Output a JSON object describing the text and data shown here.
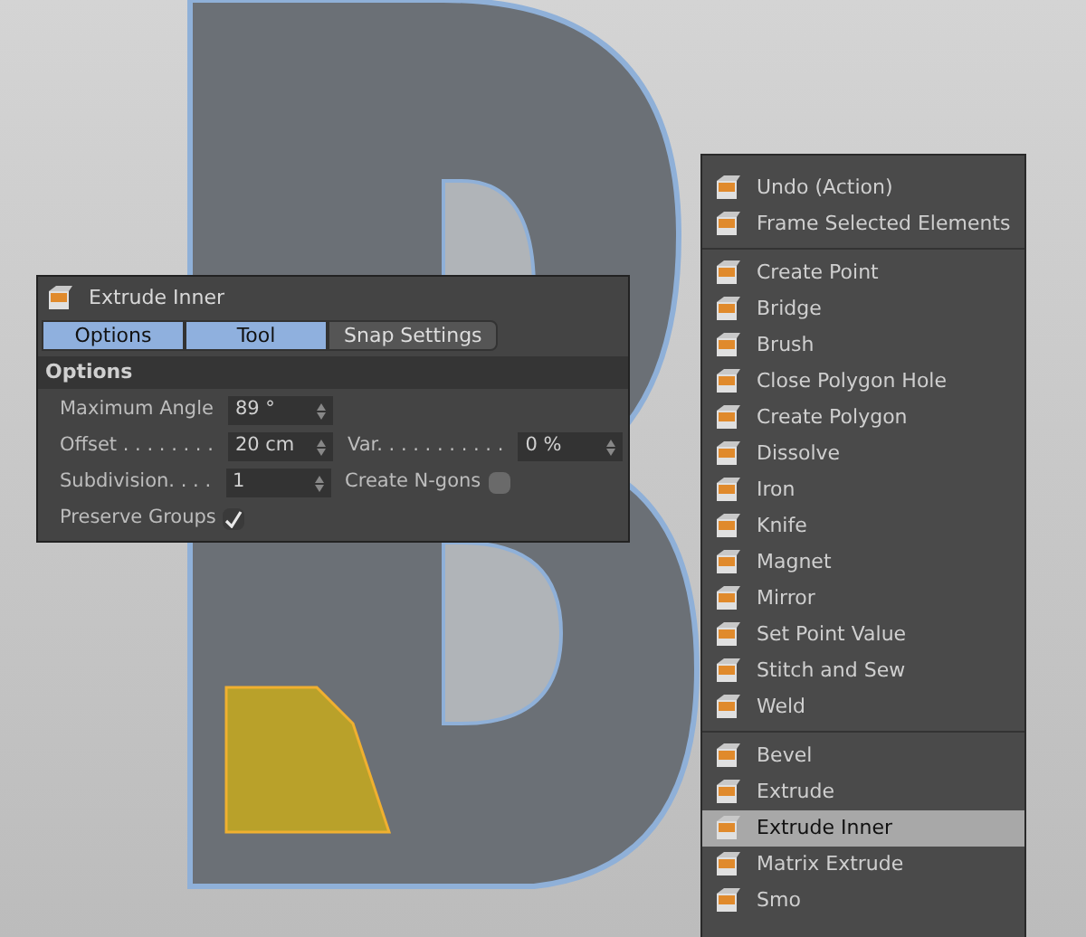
{
  "dialog": {
    "title": "Extrude Inner",
    "tabs": [
      {
        "label": "Options",
        "selected": true
      },
      {
        "label": "Tool",
        "selected": true
      },
      {
        "label": "Snap Settings",
        "selected": false
      }
    ],
    "section": "Options",
    "rows": [
      [
        {
          "kind": "number",
          "label": "Maximum Angle",
          "value": "89 °"
        }
      ],
      [
        {
          "kind": "number",
          "label": "Offset . . . . . . . .",
          "value": "20 cm"
        },
        {
          "kind": "number",
          "label": "Var. . . . . . . . . . .",
          "value": "0 %"
        }
      ],
      [
        {
          "kind": "number",
          "label": "Subdivision. . . .",
          "value": "1"
        },
        {
          "kind": "checkbox",
          "label": "Create N-gons",
          "checked": false
        }
      ],
      [
        {
          "kind": "checkbox",
          "label": "Preserve Groups",
          "checked": true
        }
      ]
    ]
  },
  "menu": {
    "sections": [
      [
        {
          "label": "Undo (Action)",
          "selected": false
        },
        {
          "label": "Frame Selected Elements",
          "selected": false
        }
      ],
      [
        {
          "label": "Create Point",
          "selected": false
        },
        {
          "label": "Bridge",
          "selected": false
        },
        {
          "label": "Brush",
          "selected": false
        },
        {
          "label": "Close Polygon Hole",
          "selected": false
        },
        {
          "label": "Create Polygon",
          "selected": false
        },
        {
          "label": "Dissolve",
          "selected": false
        },
        {
          "label": "Iron",
          "selected": false
        },
        {
          "label": "Knife",
          "selected": false
        },
        {
          "label": "Magnet",
          "selected": false
        },
        {
          "label": "Mirror",
          "selected": false
        },
        {
          "label": "Set Point Value",
          "selected": false
        },
        {
          "label": "Stitch and Sew",
          "selected": false
        },
        {
          "label": "Weld",
          "selected": false
        }
      ],
      [
        {
          "label": "Bevel",
          "selected": false
        },
        {
          "label": "Extrude",
          "selected": false
        },
        {
          "label": "Extrude Inner",
          "selected": true
        },
        {
          "label": "Matrix Extrude",
          "selected": false
        },
        {
          "label": "Smo",
          "selected": false
        }
      ]
    ]
  }
}
